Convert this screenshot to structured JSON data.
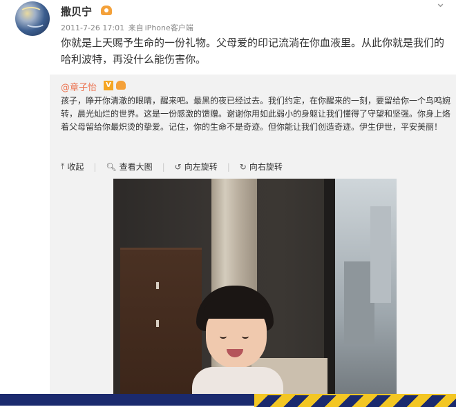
{
  "post": {
    "username": "撒贝宁",
    "meta": {
      "time": "2011-7-26 17:01",
      "source_prefix": "来自",
      "source": "iPhone客户端"
    },
    "text": "你就是上天赐予生命的一份礼物。父母爱的印记流淌在你血液里。从此你就是我们的哈利波特，再没什么能伤害你。"
  },
  "repost": {
    "username": "@章子怡",
    "verified_badge": "V",
    "text": "孩子，睁开你清澈的眼睛，醒来吧。最黑的夜已经过去。我们约定，在你醒来的一刻，要留给你一个鸟鸣婉转，晨光灿烂的世界。这是一份感激的馈赠。谢谢你用如此弱小的身躯让我们懂得了守望和坚强。你身上烙着父母留给你最炽烫的挚爱。记住，你的生命不是奇迹。但你能让我们创造奇迹。伊生伊世，平安美丽！",
    "actions": [
      "收起",
      "查看大图",
      "向左旋转",
      "向右旋转"
    ]
  },
  "icons": [
    "avatar-image",
    "vip-badge",
    "more-chevron-icon",
    "collapse-icon",
    "zoom-icon",
    "rotate-left-icon",
    "rotate-right-icon"
  ],
  "colors": {
    "repost_username": "#eb7350",
    "verified": "#f5a623",
    "repost_bg": "#f2f2f2"
  }
}
